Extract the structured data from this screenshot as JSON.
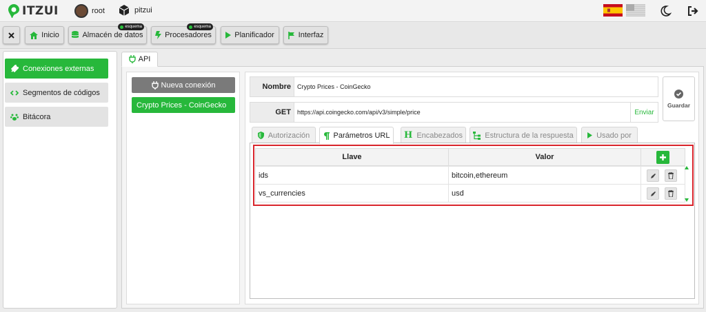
{
  "header": {
    "logo_text": "ITZUI",
    "user": "root",
    "project": "pitzui"
  },
  "toolbar": {
    "inicio": "Inicio",
    "almacen": "Almacén de datos",
    "procesadores": "Procesadores",
    "planificador": "Planificador",
    "interfaz": "Interfaz",
    "badge": "esquema"
  },
  "sidebar": {
    "items": [
      {
        "label": "Conexiones externas",
        "active": true
      },
      {
        "label": "Segmentos de códigos",
        "active": false
      },
      {
        "label": "Bitácora",
        "active": false
      }
    ]
  },
  "main_tab": "API",
  "connections": {
    "new_button": "Nueva conexión",
    "items": [
      "Crypto Prices - CoinGecko"
    ]
  },
  "form": {
    "name_label": "Nombre",
    "name_value": "Crypto Prices - CoinGecko",
    "method": "GET",
    "url": "https://api.coingecko.com/api/v3/simple/price",
    "send": "Enviar",
    "save": "Guardar"
  },
  "subtabs": [
    "Autorización",
    "Parámetros URL",
    "Encabezados",
    "Estructura de la respuesta",
    "Usado por"
  ],
  "table": {
    "headers": [
      "Llave",
      "Valor"
    ],
    "rows": [
      {
        "key": "ids",
        "value": "bitcoin,ethereum"
      },
      {
        "key": "vs_currencies",
        "value": "usd"
      }
    ]
  },
  "colors": {
    "accent": "#27b83b",
    "highlight": "#d9242b"
  }
}
